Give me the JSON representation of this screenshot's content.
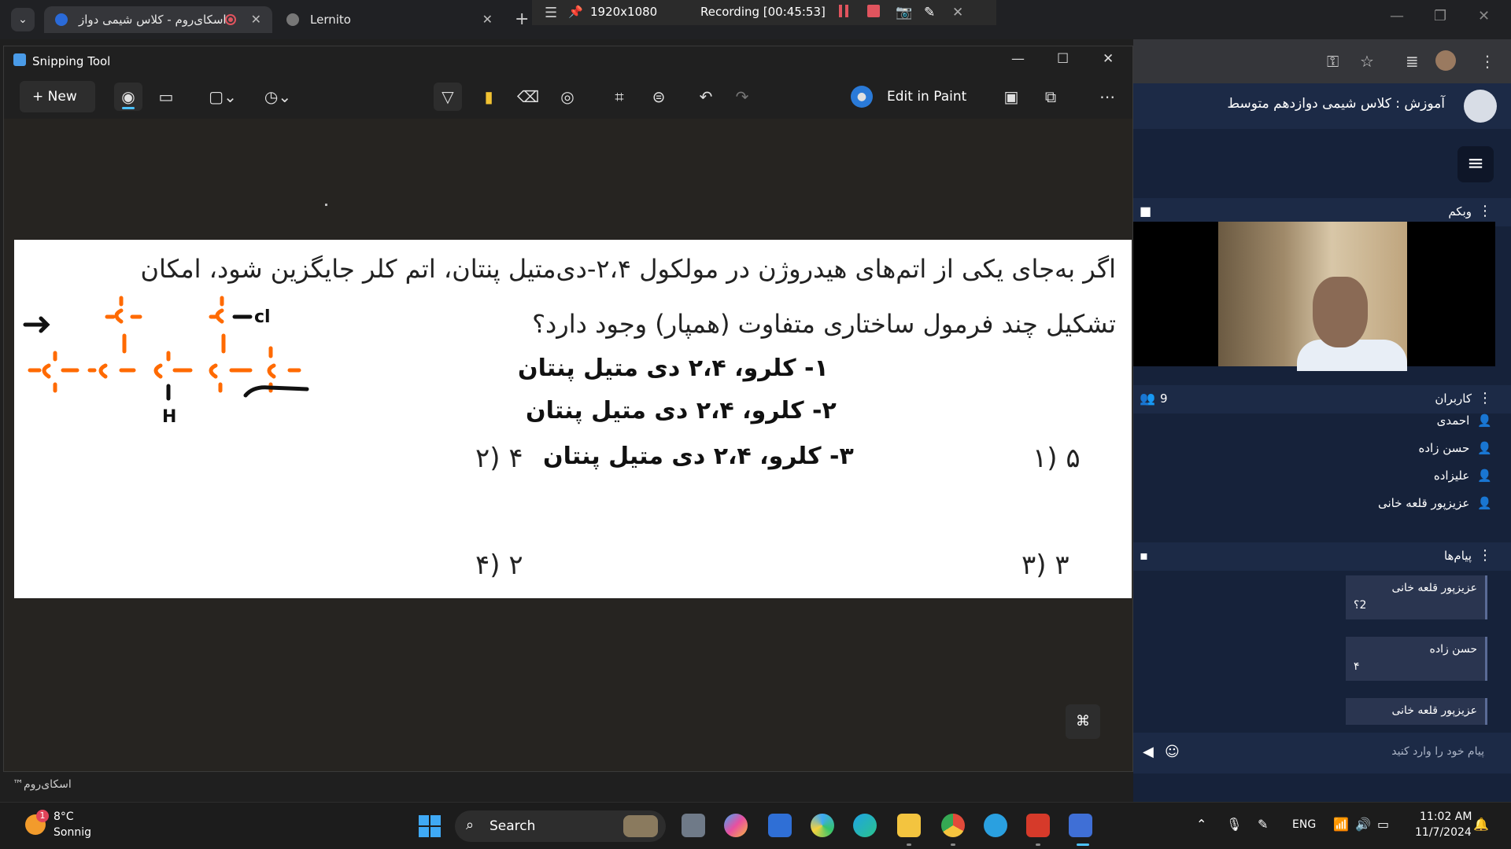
{
  "browser": {
    "tabs": [
      {
        "title": "اسکای‌روم - کلاس شیمی دواز"
      },
      {
        "title": "Lernito"
      }
    ],
    "recording": {
      "resolution": "1920x1080",
      "status": "Recording [00:45:53]"
    }
  },
  "snipping": {
    "title": "Snipping Tool",
    "new_label": "New",
    "edit_paint": "Edit in Paint",
    "capture": {
      "question_line1": "اگر به‌جای یکی از اتم‌های هیدروژن در مولکول ۲،۴-دی‌متیل پنتان، اتم کلر جایگزین شود، امکان",
      "question_line2": "تشکیل چند فرمول ساختاری متفاوت (همپار) وجود دارد؟",
      "handwritten": [
        "۱- کلرو، ۲،۴ دی متیل پنتان",
        "۲- کلرو، ۲،۴ دی متیل پنتان",
        "۳- کلرو، ۲،۴ دی متیل پنتان"
      ],
      "options": {
        "o1": "۵ (۱",
        "o2": "۴ (۲",
        "o3": "۳ (۳",
        "o4": "۲ (۴"
      },
      "structure_labels": {
        "cl": "cl",
        "h": "H"
      }
    }
  },
  "skyroom": {
    "class_title": "آموزش : کلاس شیمی دوازدهم متوسط",
    "webcam_label": "وبکم",
    "users_label": "کاربران",
    "users_count": "9",
    "users": [
      "احمدی",
      "حسن زاده",
      "علیزاده",
      "عزیزپور قلعه خانی"
    ],
    "messages_label": "پیام‌ها",
    "messages": [
      {
        "author": "عزیزپور قلعه خانی",
        "text": "2؟"
      },
      {
        "author": "حسن زاده",
        "text": "۴"
      },
      {
        "author": "عزیزپور قلعه خانی",
        "text": ""
      }
    ],
    "input_placeholder": "پیام خود را وارد کنید",
    "brand": "اسکای‌روم™"
  },
  "taskbar": {
    "weather_temp": "8°C",
    "weather_desc": "Sonnig",
    "weather_badge": "1",
    "search_label": "Search",
    "lang": "ENG",
    "time": "11:02 AM",
    "date": "11/7/2024"
  },
  "colors": {
    "accent": "#4cc2ff",
    "record": "#e0545e",
    "panel": "#16223a",
    "marker_orange": "#ff6a00"
  }
}
